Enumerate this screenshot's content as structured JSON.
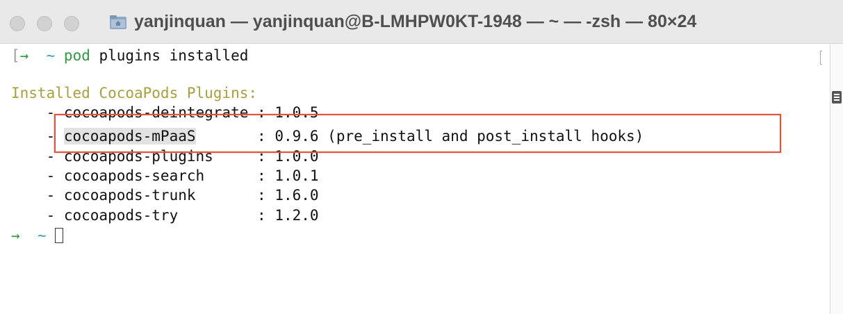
{
  "window": {
    "title": "yanjinquan — yanjinquan@B-LMHPW0KT-1948 — ~ — -zsh — 80×24",
    "traffic_lights": [
      "close",
      "minimize",
      "zoom"
    ],
    "title_icon": "folder-home-icon"
  },
  "terminal": {
    "prompt1": {
      "bracket": "[",
      "arrow": "→",
      "dir": "~",
      "command": "pod",
      "args": " plugins installed"
    },
    "header": "Installed CocoaPods Plugins:",
    "plugins": [
      {
        "dash": "    - ",
        "name": "cocoapods-deintegrate",
        "sep": " : ",
        "version": "1.0.5"
      },
      {
        "dash": "    - ",
        "name": "cocoapods-mPaaS",
        "sep": "       : ",
        "version": "0.9.6 (pre_install and post_install hooks)"
      },
      {
        "dash": "    - ",
        "name": "cocoapods-plugins",
        "sep": "     : ",
        "version": "1.0.0"
      },
      {
        "dash": "    - ",
        "name": "cocoapods-search",
        "sep": "      : ",
        "version": "1.0.1"
      },
      {
        "dash": "    - ",
        "name": "cocoapods-trunk",
        "sep": "       : ",
        "version": "1.6.0"
      },
      {
        "dash": "    - ",
        "name": "cocoapods-try",
        "sep": "         : ",
        "version": "1.2.0"
      }
    ],
    "prompt2": {
      "arrow": "→",
      "dir": "~"
    }
  },
  "colors": {
    "prompt_green": "#2a9d3e",
    "tilde_cyan": "#2fa3b7",
    "header_yellow": "#a8a03a",
    "annotation_red": "#e0533a"
  }
}
